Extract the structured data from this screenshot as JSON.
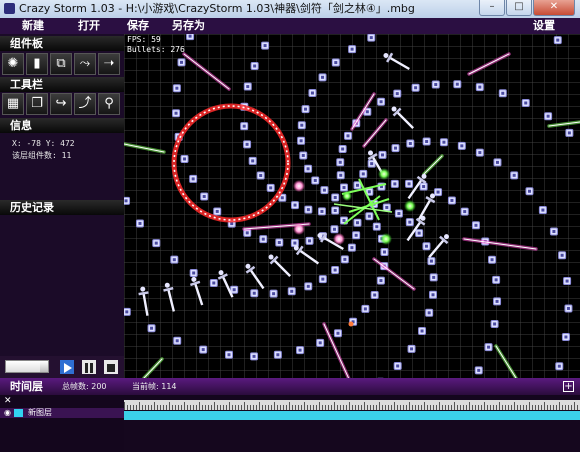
{
  "window": {
    "title": "Crazy Storm 1.03 - H:\\小游戏\\CrazyStorm 1.03\\神器\\剑符「剑之林④」.mbg"
  },
  "menu": {
    "new": "新建",
    "open": "打开",
    "save": "保存",
    "save_as": "另存为",
    "settings": "设置"
  },
  "sidebar": {
    "components_title": "组件板",
    "tools_title": "工具栏",
    "info_title": "信息",
    "info_coords": "X: -78  Y: 472",
    "info_count": "该层组件数: 11",
    "history_title": "历史记录"
  },
  "playback": {
    "speed_level": 0.8
  },
  "canvas": {
    "fps": "FPS: 59",
    "bullets": "Bullets: 276"
  },
  "timeline": {
    "title": "时间层",
    "total_frames": "总帧数: 200",
    "current_frame": "当前帧: 114",
    "layer_name": "新图层",
    "layer_color": "#32d2f0"
  },
  "colors": {
    "accent_purple": "#5a1a7f",
    "track": "#3bd0ea",
    "bullet": "#8a8ad8",
    "ring": "#ff3b3b"
  },
  "icons": [
    "emitter-icon",
    "laser-icon",
    "mask-icon",
    "rebound-icon",
    "force-field-icon",
    "layer-tool-icon",
    "copy-icon",
    "turn-icon",
    "rotate-icon",
    "zoom-icon",
    "play-icon",
    "pause-icon",
    "stop-icon",
    "eye-icon",
    "plus-icon",
    "close-icon"
  ]
}
